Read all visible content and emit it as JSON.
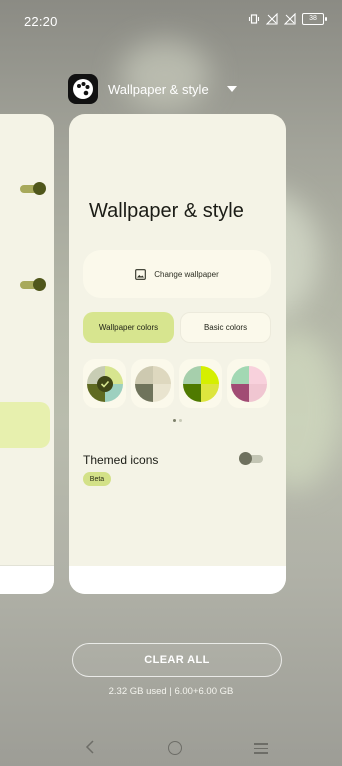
{
  "status_bar": {
    "time": "22:20",
    "battery": "38"
  },
  "app": {
    "title": "Wallpaper & style"
  },
  "card": {
    "heading": "Wallpaper & style",
    "change_wallpaper": "Change wallpaper",
    "tabs": [
      {
        "label": "Wallpaper colors",
        "selected": true
      },
      {
        "label": "Basic colors",
        "selected": false
      }
    ],
    "swatches": [
      {
        "name": "olive",
        "colors": [
          "#d7e58f",
          "#9dd0bf",
          "#5f6a21",
          "#c8cdb4"
        ],
        "selected": true
      },
      {
        "name": "sage",
        "colors": [
          "#ded8bf",
          "#e9e4cf",
          "#6f735b",
          "#cdc9b0"
        ],
        "selected": false
      },
      {
        "name": "lime",
        "colors": [
          "#d5ef00",
          "#dde53e",
          "#4f7a00",
          "#a6cfac"
        ],
        "selected": false
      },
      {
        "name": "pink",
        "colors": [
          "#f8d1dc",
          "#f0c6d1",
          "#a14c74",
          "#a2d8b3"
        ],
        "selected": false
      }
    ],
    "themed_icons_label": "Themed icons",
    "beta_label": "Beta"
  },
  "clear_all_label": "CLEAR ALL",
  "memory_info": "2.32 GB used | 6.00+6.00 GB",
  "colors": {
    "card_bg": "#f4f3e6",
    "accent": "#d7e58f"
  }
}
